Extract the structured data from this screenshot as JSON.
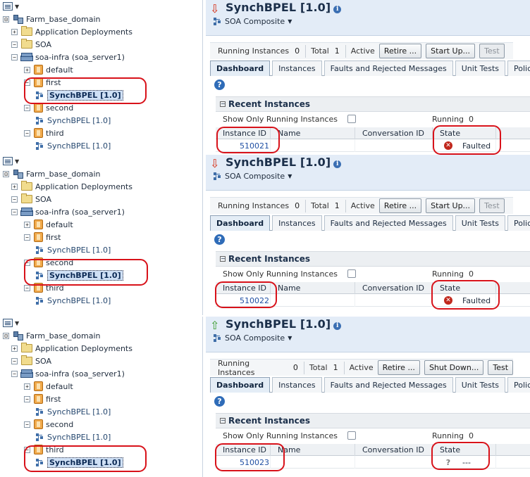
{
  "panels": [
    {
      "tree": [
        {
          "label": "Farm_base_domain",
          "level": 0,
          "toggle": "⊟",
          "icon": "farm-icon"
        },
        {
          "label": "Application Deployments",
          "level": 1,
          "toggle": "+",
          "icon": "folder-icon"
        },
        {
          "label": "SOA",
          "level": 1,
          "toggle": "−",
          "icon": "folder-icon"
        },
        {
          "label": "soa-infra (soa_server1)",
          "level": 2,
          "toggle": "−",
          "icon": "server-icon"
        },
        {
          "label": "default",
          "level": 3,
          "toggle": "+",
          "icon": "partition-icon"
        },
        {
          "label": "first",
          "level": 3,
          "toggle": "−",
          "icon": "partition-icon"
        },
        {
          "label": "SynchBPEL [1.0]",
          "level": 4,
          "toggle": "",
          "icon": "composite-icon",
          "selected": true
        },
        {
          "label": "second",
          "level": 3,
          "toggle": "−",
          "icon": "partition-icon"
        },
        {
          "label": "SynchBPEL [1.0]",
          "level": 4,
          "toggle": "",
          "icon": "composite-icon"
        },
        {
          "label": "third",
          "level": 3,
          "toggle": "−",
          "icon": "partition-icon"
        },
        {
          "label": "SynchBPEL [1.0]",
          "level": 4,
          "toggle": "",
          "icon": "composite-icon"
        }
      ],
      "header": {
        "status": "down",
        "status_icon": "red-down-arrow-icon",
        "title": "SynchBPEL [1.0]",
        "subtitle": "SOA Composite"
      },
      "toolbar": {
        "running_label": "Running Instances",
        "running_value": "0",
        "total_label": "Total",
        "total_value": "1",
        "state": "Active",
        "retire": "Retire ...",
        "startup": "Start Up...",
        "test": "Test",
        "test_disabled": true
      },
      "tabs": [
        "Dashboard",
        "Instances",
        "Faults and Rejected Messages",
        "Unit Tests",
        "Policies"
      ],
      "recent": {
        "title": "Recent Instances",
        "show_only_running": "Show Only Running Instances",
        "running_label": "Running",
        "running_value": "0",
        "columns": [
          "Instance ID",
          "Name",
          "Conversation ID",
          "State"
        ],
        "instance_id": "510021",
        "state": "Faulted",
        "state_icon": "error-icon"
      }
    },
    {
      "tree": [
        {
          "label": "Farm_base_domain",
          "level": 0,
          "toggle": "⊟",
          "icon": "farm-icon"
        },
        {
          "label": "Application Deployments",
          "level": 1,
          "toggle": "+",
          "icon": "folder-icon"
        },
        {
          "label": "SOA",
          "level": 1,
          "toggle": "−",
          "icon": "folder-icon"
        },
        {
          "label": "soa-infra (soa_server1)",
          "level": 2,
          "toggle": "−",
          "icon": "server-icon"
        },
        {
          "label": "default",
          "level": 3,
          "toggle": "+",
          "icon": "partition-icon"
        },
        {
          "label": "first",
          "level": 3,
          "toggle": "−",
          "icon": "partition-icon"
        },
        {
          "label": "SynchBPEL [1.0]",
          "level": 4,
          "toggle": "",
          "icon": "composite-icon"
        },
        {
          "label": "second",
          "level": 3,
          "toggle": "−",
          "icon": "partition-icon"
        },
        {
          "label": "SynchBPEL [1.0]",
          "level": 4,
          "toggle": "",
          "icon": "composite-icon",
          "selected": true
        },
        {
          "label": "third",
          "level": 3,
          "toggle": "−",
          "icon": "partition-icon"
        },
        {
          "label": "SynchBPEL [1.0]",
          "level": 4,
          "toggle": "",
          "icon": "composite-icon"
        }
      ],
      "header": {
        "status": "down",
        "status_icon": "red-down-arrow-icon",
        "title": "SynchBPEL [1.0]",
        "subtitle": "SOA Composite"
      },
      "toolbar": {
        "running_label": "Running Instances",
        "running_value": "0",
        "total_label": "Total",
        "total_value": "1",
        "state": "Active",
        "retire": "Retire ...",
        "startup": "Start Up...",
        "test": "Test",
        "test_disabled": true
      },
      "tabs": [
        "Dashboard",
        "Instances",
        "Faults and Rejected Messages",
        "Unit Tests",
        "Policies"
      ],
      "recent": {
        "title": "Recent Instances",
        "show_only_running": "Show Only Running Instances",
        "running_label": "Running",
        "running_value": "0",
        "columns": [
          "Instance ID",
          "Name",
          "Conversation ID",
          "State"
        ],
        "instance_id": "510022",
        "state": "Faulted",
        "state_icon": "error-icon"
      }
    },
    {
      "tree": [
        {
          "label": "Farm_base_domain",
          "level": 0,
          "toggle": "⊟",
          "icon": "farm-icon"
        },
        {
          "label": "Application Deployments",
          "level": 1,
          "toggle": "+",
          "icon": "folder-icon"
        },
        {
          "label": "SOA",
          "level": 1,
          "toggle": "−",
          "icon": "folder-icon"
        },
        {
          "label": "soa-infra (soa_server1)",
          "level": 2,
          "toggle": "−",
          "icon": "server-icon"
        },
        {
          "label": "default",
          "level": 3,
          "toggle": "+",
          "icon": "partition-icon"
        },
        {
          "label": "first",
          "level": 3,
          "toggle": "−",
          "icon": "partition-icon"
        },
        {
          "label": "SynchBPEL [1.0]",
          "level": 4,
          "toggle": "",
          "icon": "composite-icon"
        },
        {
          "label": "second",
          "level": 3,
          "toggle": "−",
          "icon": "partition-icon"
        },
        {
          "label": "SynchBPEL [1.0]",
          "level": 4,
          "toggle": "",
          "icon": "composite-icon"
        },
        {
          "label": "third",
          "level": 3,
          "toggle": "−",
          "icon": "partition-icon"
        },
        {
          "label": "SynchBPEL [1.0]",
          "level": 4,
          "toggle": "",
          "icon": "composite-icon",
          "selected": true
        }
      ],
      "header": {
        "status": "up",
        "status_icon": "green-up-arrow-icon",
        "title": "SynchBPEL [1.0]",
        "subtitle": "SOA Composite"
      },
      "toolbar": {
        "running_label": "Running Instances",
        "running_value": "0",
        "total_label": "Total",
        "total_value": "1",
        "state": "Active",
        "retire": "Retire ...",
        "startup": "Shut Down...",
        "test": "Test",
        "test_disabled": false
      },
      "tabs": [
        "Dashboard",
        "Instances",
        "Faults and Rejected Messages",
        "Unit Tests",
        "Policies"
      ],
      "recent": {
        "title": "Recent Instances",
        "show_only_running": "Show Only Running Instances",
        "running_label": "Running",
        "running_value": "0",
        "columns": [
          "Instance ID",
          "Name",
          "Conversation ID",
          "State"
        ],
        "instance_id": "510023",
        "state": "---",
        "state_icon": "unknown-state-icon"
      }
    }
  ],
  "colors": {
    "annotation_ring": "#d8121a",
    "header_bg": "#e3ecf7",
    "link": "#1f4fa3",
    "faulted": "#c0271c"
  }
}
